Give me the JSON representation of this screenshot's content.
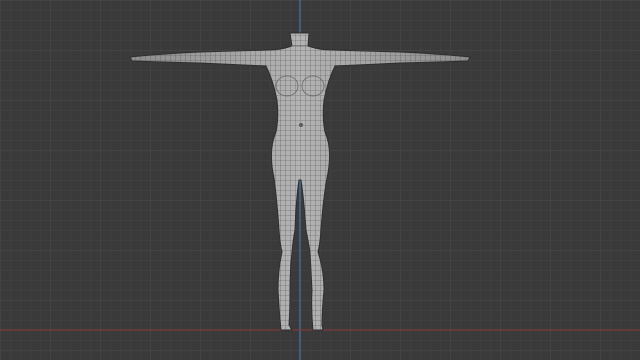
{
  "viewport": {
    "view": "front-orthographic",
    "shading": "solid",
    "overlay": "wireframe",
    "object": "humanoid-body-mesh",
    "pose": "T-pose",
    "colors": {
      "background": "#3a3a3a",
      "grid_minor": "#444444",
      "grid_major": "#4c4c4c",
      "z_axis": "#4f7fbf",
      "x_axis": "#8a3a3a",
      "mesh_fill": "#a9a9a9",
      "mesh_wire": "#555555"
    }
  }
}
